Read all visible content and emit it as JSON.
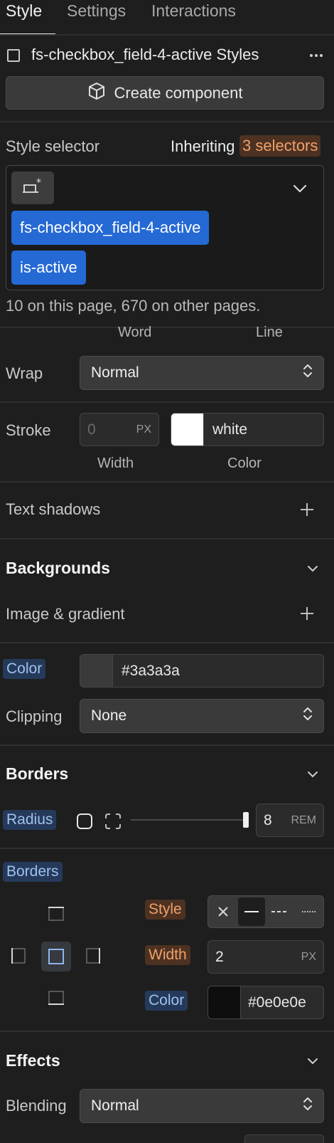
{
  "tabs": [
    "Style",
    "Settings",
    "Interactions"
  ],
  "element": {
    "title": "fs-checkbox_field-4-active Styles",
    "more_icon": "ellipsis-icon",
    "create_component_label": "Create component"
  },
  "selector": {
    "label": "Style selector",
    "inheriting_text": "Inheriting",
    "inheriting_count": "3 selectors",
    "chips": [
      "fs-checkbox_field-4-active",
      "is-active"
    ],
    "usage_text": "10 on this page, 670 on other pages."
  },
  "typography": {
    "word_label": "Word",
    "line_label": "Line",
    "wrap_label": "Wrap",
    "wrap_value": "Normal",
    "stroke_label": "Stroke",
    "stroke_width_placeholder": "0",
    "stroke_width_unit": "PX",
    "stroke_color_name": "white",
    "stroke_color_hex": "#ffffff",
    "width_caption": "Width",
    "color_caption": "Color",
    "text_shadows_label": "Text shadows"
  },
  "backgrounds": {
    "title": "Backgrounds",
    "image_gradient_label": "Image & gradient",
    "color_label": "Color",
    "color_value": "#3a3a3a",
    "clipping_label": "Clipping",
    "clipping_value": "None"
  },
  "borders": {
    "title": "Borders",
    "radius_label": "Radius",
    "radius_value": "8",
    "radius_unit": "REM",
    "radius_slider_fraction": 1.0,
    "borders_label": "Borders",
    "style_label": "Style",
    "width_label": "Width",
    "width_value": "2",
    "width_unit": "PX",
    "color_label": "Color",
    "color_value": "#0e0e0e",
    "style_options": [
      "none",
      "solid",
      "dashed",
      "dotted"
    ],
    "style_selected": "solid"
  },
  "effects": {
    "title": "Effects",
    "blending_label": "Blending",
    "blending_value": "Normal"
  },
  "colors": {
    "accent_blue": "#2569d4",
    "accent_orange": "#f0a06a",
    "panel_bg": "#1e1e1e"
  }
}
